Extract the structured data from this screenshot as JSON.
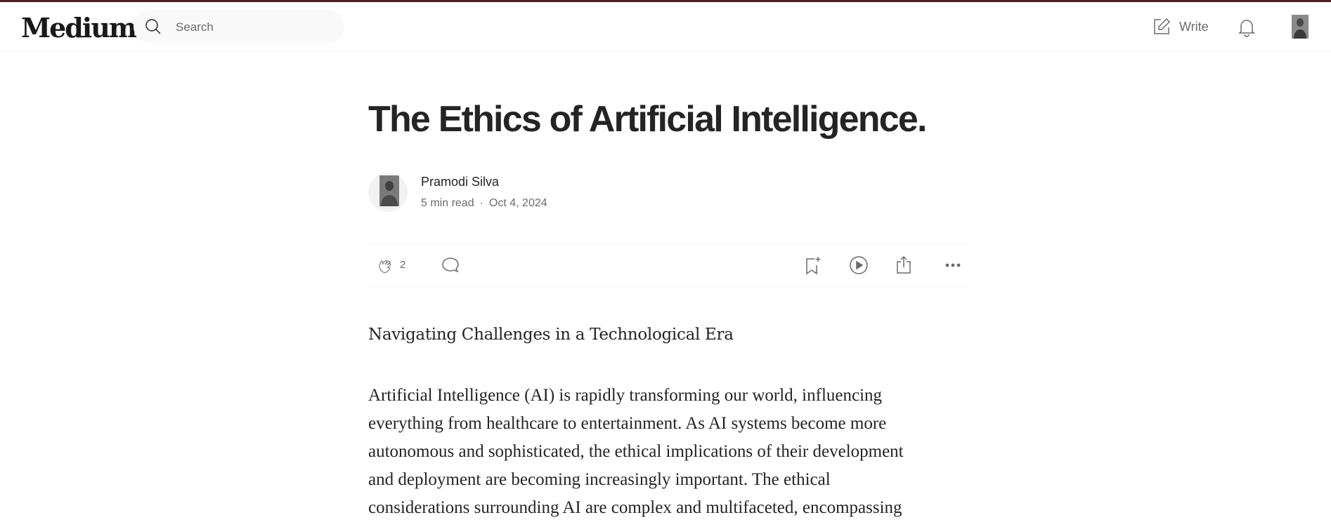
{
  "header": {
    "logo": "Medium",
    "search_placeholder": "Search",
    "write_label": "Write"
  },
  "article": {
    "title": "The Ethics of Artificial Intelligence.",
    "author": "Pramodi Silva",
    "read_time": "5 min read",
    "separator": "·",
    "date": "Oct 4, 2024",
    "clap_count": "2",
    "subtitle": "Navigating Challenges in a Technological Era",
    "body_lines": [
      "Artificial Intelligence (AI) is rapidly transforming our world, influencing",
      "everything from healthcare to entertainment. As AI systems become more",
      "autonomous and sophisticated, the ethical implications of their development",
      "and deployment are becoming increasingly important. The ethical",
      "considerations surrounding AI are complex and multifaceted, encompassing"
    ]
  },
  "colors": {
    "accent_topline": "#4a1f2a",
    "text_primary": "#242424",
    "text_secondary": "#6b6b6b"
  },
  "icons": [
    "search-icon",
    "write-icon",
    "bell-icon",
    "clap-icon",
    "comment-icon",
    "bookmark-add-icon",
    "play-icon",
    "share-icon",
    "more-icon"
  ]
}
